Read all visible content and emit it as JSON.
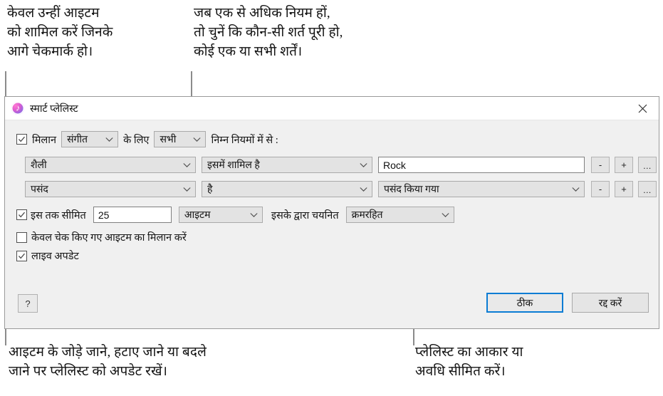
{
  "callouts": {
    "top_left": "केवल उन्हीं आइटम\nको शामिल करें जिनके\nआगे चेकमार्क हो।",
    "top_right": "जब एक से अधिक नियम हों,\nतो चुनें कि कौन-सी शर्त पूरी हो,\nकोई एक या सभी शर्तें।",
    "bottom_left": "आइटम के जोड़े जाने, हटाए जाने या बदले\nजाने पर प्लेलिस्ट को अपडेट रखें।",
    "bottom_right": "प्लेलिस्ट का आकार या\nअवधि सीमित करें।"
  },
  "dialog": {
    "title": "स्मार्ट प्लेलिस्ट",
    "icon": "itunes-music-note-icon",
    "close_label": "×",
    "match_row": {
      "checkbox_checked": true,
      "label_match": "मिलान",
      "source_select": "संगीत",
      "label_for": "के लिए",
      "condition_select": "सभी",
      "trailing_label": "निम्न नियमों में से :"
    },
    "rules": [
      {
        "field": "शैली",
        "operator": "इसमें शामिल है",
        "value": "Rock",
        "value_type": "text",
        "remove_label": "-",
        "add_label": "+",
        "more_label": "..."
      },
      {
        "field": "पसंद",
        "operator": "है",
        "value": "पसंद किया गया",
        "value_type": "select",
        "remove_label": "-",
        "add_label": "+",
        "more_label": "..."
      }
    ],
    "limit_row": {
      "checkbox_checked": true,
      "label": "इस तक सीमित",
      "amount": "25",
      "unit_select": "आइटम",
      "label_selected_by": "इसके द्वारा चयनित",
      "order_select": "क्रमरहित"
    },
    "checked_only_row": {
      "checkbox_checked": false,
      "label": "केवल चेक किए गए आइटम का मिलान करें"
    },
    "live_update_row": {
      "checkbox_checked": true,
      "label": "लाइव अपडेट"
    },
    "footer": {
      "help_label": "?",
      "ok_label": "ठीक",
      "cancel_label": "रद्द करें"
    }
  },
  "colors": {
    "accent": "#0a7cd4",
    "dialog_bg": "#f0f0f0",
    "titlebar_bg": "#ffffff",
    "control_bg": "#e3e3e3",
    "leader_line": "#8b8b8b"
  }
}
